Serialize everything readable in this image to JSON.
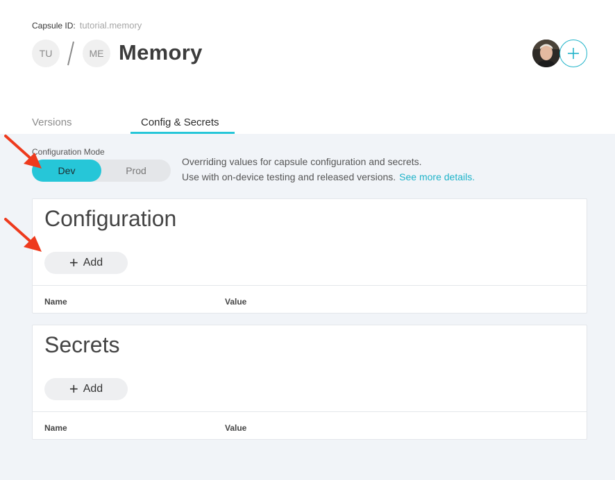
{
  "header": {
    "capsule_id_label": "Capsule ID:",
    "capsule_id_value": "tutorial.memory",
    "breadcrumb_1": "TU",
    "breadcrumb_2": "ME",
    "title": "Memory"
  },
  "tabs": [
    {
      "label": "Versions",
      "active": false
    },
    {
      "label": "Config & Secrets",
      "active": true
    }
  ],
  "mode": {
    "label": "Configuration Mode",
    "options": [
      "Dev",
      "Prod"
    ],
    "selected": "Dev"
  },
  "description": {
    "line1": "Overriding values for capsule configuration and secrets.",
    "line2": "Use with on-device testing and released versions.",
    "link": "See more details."
  },
  "configuration": {
    "title": "Configuration",
    "add_label": "Add",
    "columns": [
      "Name",
      "Value"
    ]
  },
  "secrets": {
    "title": "Secrets",
    "add_label": "Add",
    "columns": [
      "Name",
      "Value"
    ]
  },
  "colors": {
    "accent": "#26c6d8",
    "link": "#1fb3c9",
    "annotation_arrow": "#ee3a1d",
    "content_bg": "#f1f4f8"
  },
  "icons": {
    "add_member": "plus-icon",
    "add_button": "plus-icon",
    "annotation": "arrow-icon"
  }
}
